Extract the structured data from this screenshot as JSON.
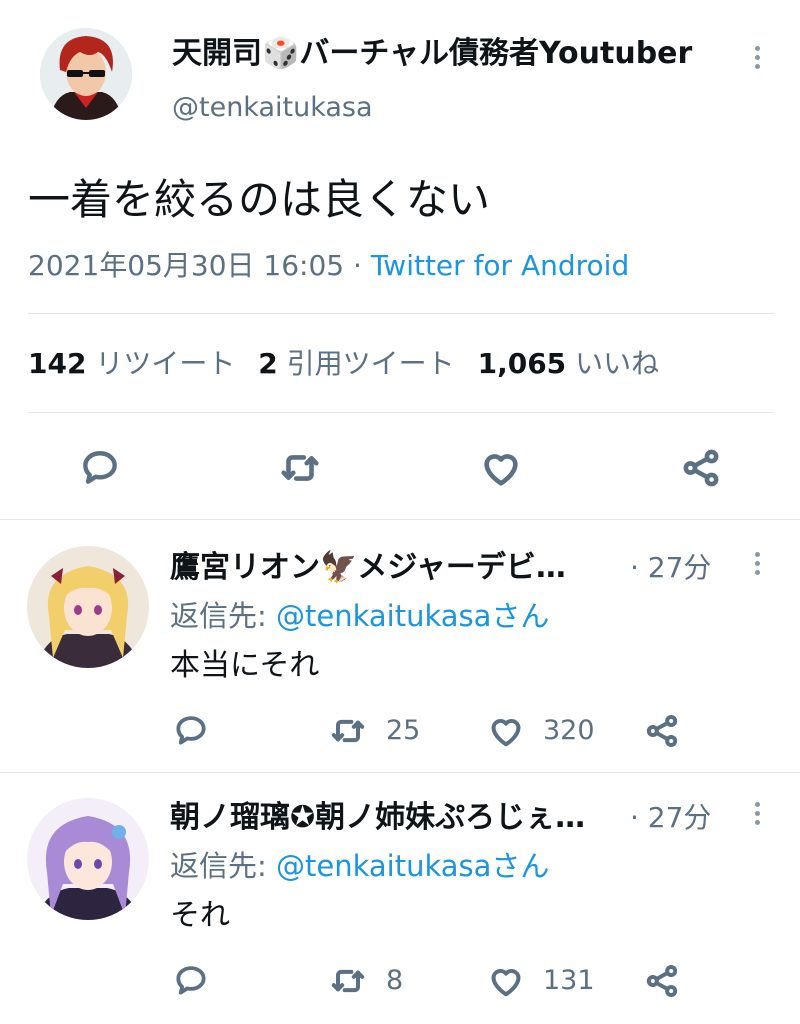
{
  "main_tweet": {
    "author_name": "天開司🎲バーチャル債務者Youtuber",
    "author_handle": "@tenkaitukasa",
    "text": "一着を絞るのは良くない",
    "date": "2021年05月30日 16:05",
    "separator": "·",
    "source": "Twitter for Android",
    "stats": {
      "retweets_count": "142",
      "retweets_label": "リツイート",
      "quotes_count": "2",
      "quotes_label": "引用ツイート",
      "likes_count": "1,065",
      "likes_label": "いいね"
    }
  },
  "replies": [
    {
      "author_name": "鷹宮リオン🦅メジャーデビ…",
      "time": "· 27分",
      "reply_to_prefix": "返信先: ",
      "reply_to_handle": "@tenkaitukasaさん",
      "text": "本当にそれ",
      "retweets": "25",
      "likes": "320"
    },
    {
      "author_name": "朝ノ瑠璃✪朝ノ姉妹ぷろじぇ…",
      "time": "· 27分",
      "reply_to_prefix": "返信先: ",
      "reply_to_handle": "@tenkaitukasaさん",
      "text": "それ",
      "retweets": "8",
      "likes": "131"
    }
  ],
  "icons": [
    "reply-icon",
    "retweet-icon",
    "like-icon",
    "share-icon",
    "more-options-icon"
  ],
  "colors": {
    "link": "#1b95e0",
    "muted": "#5b7083",
    "divider": "#e1e8ed"
  }
}
